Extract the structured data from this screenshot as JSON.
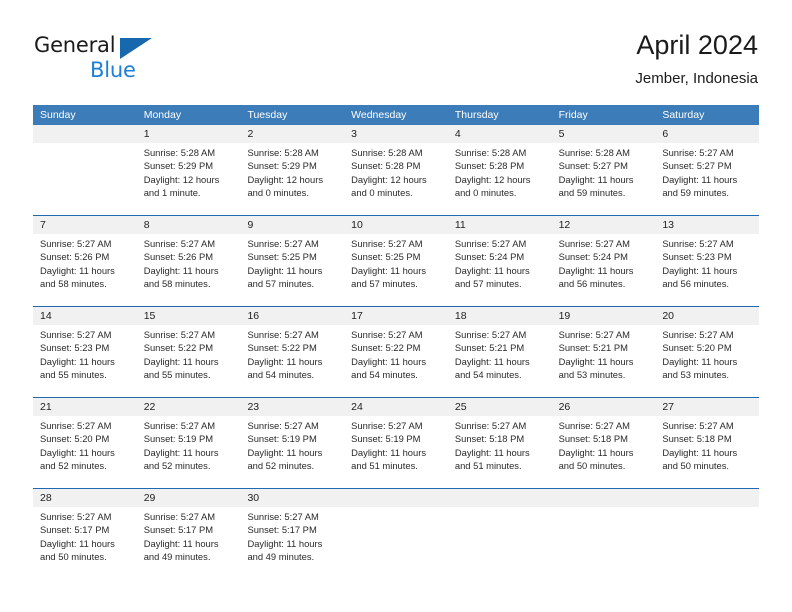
{
  "brand": {
    "name_part1": "General",
    "name_part2": "Blue",
    "accent_color": "#1868ae",
    "blue_color": "#1e7fd4"
  },
  "header": {
    "title": "April 2024",
    "subtitle": "Jember, Indonesia",
    "header_bg_color": "#3c7cb9",
    "row_divider_color": "#1f69b0",
    "number_band_color": "#f1f1f1"
  },
  "weekday_headers": [
    "Sunday",
    "Monday",
    "Tuesday",
    "Wednesday",
    "Thursday",
    "Friday",
    "Saturday"
  ],
  "weeks": [
    {
      "days": [
        {
          "number": "",
          "lines": [
            "",
            "",
            "",
            ""
          ],
          "empty": true
        },
        {
          "number": "1",
          "lines": [
            "Sunrise: 5:28 AM",
            "Sunset: 5:29 PM",
            "Daylight: 12 hours",
            "and 1 minute."
          ],
          "empty": false
        },
        {
          "number": "2",
          "lines": [
            "Sunrise: 5:28 AM",
            "Sunset: 5:29 PM",
            "Daylight: 12 hours",
            "and 0 minutes."
          ],
          "empty": false
        },
        {
          "number": "3",
          "lines": [
            "Sunrise: 5:28 AM",
            "Sunset: 5:28 PM",
            "Daylight: 12 hours",
            "and 0 minutes."
          ],
          "empty": false
        },
        {
          "number": "4",
          "lines": [
            "Sunrise: 5:28 AM",
            "Sunset: 5:28 PM",
            "Daylight: 12 hours",
            "and 0 minutes."
          ],
          "empty": false
        },
        {
          "number": "5",
          "lines": [
            "Sunrise: 5:28 AM",
            "Sunset: 5:27 PM",
            "Daylight: 11 hours",
            "and 59 minutes."
          ],
          "empty": false
        },
        {
          "number": "6",
          "lines": [
            "Sunrise: 5:27 AM",
            "Sunset: 5:27 PM",
            "Daylight: 11 hours",
            "and 59 minutes."
          ],
          "empty": false
        }
      ]
    },
    {
      "days": [
        {
          "number": "7",
          "lines": [
            "Sunrise: 5:27 AM",
            "Sunset: 5:26 PM",
            "Daylight: 11 hours",
            "and 58 minutes."
          ],
          "empty": false
        },
        {
          "number": "8",
          "lines": [
            "Sunrise: 5:27 AM",
            "Sunset: 5:26 PM",
            "Daylight: 11 hours",
            "and 58 minutes."
          ],
          "empty": false
        },
        {
          "number": "9",
          "lines": [
            "Sunrise: 5:27 AM",
            "Sunset: 5:25 PM",
            "Daylight: 11 hours",
            "and 57 minutes."
          ],
          "empty": false
        },
        {
          "number": "10",
          "lines": [
            "Sunrise: 5:27 AM",
            "Sunset: 5:25 PM",
            "Daylight: 11 hours",
            "and 57 minutes."
          ],
          "empty": false
        },
        {
          "number": "11",
          "lines": [
            "Sunrise: 5:27 AM",
            "Sunset: 5:24 PM",
            "Daylight: 11 hours",
            "and 57 minutes."
          ],
          "empty": false
        },
        {
          "number": "12",
          "lines": [
            "Sunrise: 5:27 AM",
            "Sunset: 5:24 PM",
            "Daylight: 11 hours",
            "and 56 minutes."
          ],
          "empty": false
        },
        {
          "number": "13",
          "lines": [
            "Sunrise: 5:27 AM",
            "Sunset: 5:23 PM",
            "Daylight: 11 hours",
            "and 56 minutes."
          ],
          "empty": false
        }
      ]
    },
    {
      "days": [
        {
          "number": "14",
          "lines": [
            "Sunrise: 5:27 AM",
            "Sunset: 5:23 PM",
            "Daylight: 11 hours",
            "and 55 minutes."
          ],
          "empty": false
        },
        {
          "number": "15",
          "lines": [
            "Sunrise: 5:27 AM",
            "Sunset: 5:22 PM",
            "Daylight: 11 hours",
            "and 55 minutes."
          ],
          "empty": false
        },
        {
          "number": "16",
          "lines": [
            "Sunrise: 5:27 AM",
            "Sunset: 5:22 PM",
            "Daylight: 11 hours",
            "and 54 minutes."
          ],
          "empty": false
        },
        {
          "number": "17",
          "lines": [
            "Sunrise: 5:27 AM",
            "Sunset: 5:22 PM",
            "Daylight: 11 hours",
            "and 54 minutes."
          ],
          "empty": false
        },
        {
          "number": "18",
          "lines": [
            "Sunrise: 5:27 AM",
            "Sunset: 5:21 PM",
            "Daylight: 11 hours",
            "and 54 minutes."
          ],
          "empty": false
        },
        {
          "number": "19",
          "lines": [
            "Sunrise: 5:27 AM",
            "Sunset: 5:21 PM",
            "Daylight: 11 hours",
            "and 53 minutes."
          ],
          "empty": false
        },
        {
          "number": "20",
          "lines": [
            "Sunrise: 5:27 AM",
            "Sunset: 5:20 PM",
            "Daylight: 11 hours",
            "and 53 minutes."
          ],
          "empty": false
        }
      ]
    },
    {
      "days": [
        {
          "number": "21",
          "lines": [
            "Sunrise: 5:27 AM",
            "Sunset: 5:20 PM",
            "Daylight: 11 hours",
            "and 52 minutes."
          ],
          "empty": false
        },
        {
          "number": "22",
          "lines": [
            "Sunrise: 5:27 AM",
            "Sunset: 5:19 PM",
            "Daylight: 11 hours",
            "and 52 minutes."
          ],
          "empty": false
        },
        {
          "number": "23",
          "lines": [
            "Sunrise: 5:27 AM",
            "Sunset: 5:19 PM",
            "Daylight: 11 hours",
            "and 52 minutes."
          ],
          "empty": false
        },
        {
          "number": "24",
          "lines": [
            "Sunrise: 5:27 AM",
            "Sunset: 5:19 PM",
            "Daylight: 11 hours",
            "and 51 minutes."
          ],
          "empty": false
        },
        {
          "number": "25",
          "lines": [
            "Sunrise: 5:27 AM",
            "Sunset: 5:18 PM",
            "Daylight: 11 hours",
            "and 51 minutes."
          ],
          "empty": false
        },
        {
          "number": "26",
          "lines": [
            "Sunrise: 5:27 AM",
            "Sunset: 5:18 PM",
            "Daylight: 11 hours",
            "and 50 minutes."
          ],
          "empty": false
        },
        {
          "number": "27",
          "lines": [
            "Sunrise: 5:27 AM",
            "Sunset: 5:18 PM",
            "Daylight: 11 hours",
            "and 50 minutes."
          ],
          "empty": false
        }
      ]
    },
    {
      "days": [
        {
          "number": "28",
          "lines": [
            "Sunrise: 5:27 AM",
            "Sunset: 5:17 PM",
            "Daylight: 11 hours",
            "and 50 minutes."
          ],
          "empty": false
        },
        {
          "number": "29",
          "lines": [
            "Sunrise: 5:27 AM",
            "Sunset: 5:17 PM",
            "Daylight: 11 hours",
            "and 49 minutes."
          ],
          "empty": false
        },
        {
          "number": "30",
          "lines": [
            "Sunrise: 5:27 AM",
            "Sunset: 5:17 PM",
            "Daylight: 11 hours",
            "and 49 minutes."
          ],
          "empty": false
        },
        {
          "number": "",
          "lines": [
            "",
            "",
            "",
            ""
          ],
          "empty": true
        },
        {
          "number": "",
          "lines": [
            "",
            "",
            "",
            ""
          ],
          "empty": true
        },
        {
          "number": "",
          "lines": [
            "",
            "",
            "",
            ""
          ],
          "empty": true
        },
        {
          "number": "",
          "lines": [
            "",
            "",
            "",
            ""
          ],
          "empty": true
        }
      ]
    }
  ]
}
